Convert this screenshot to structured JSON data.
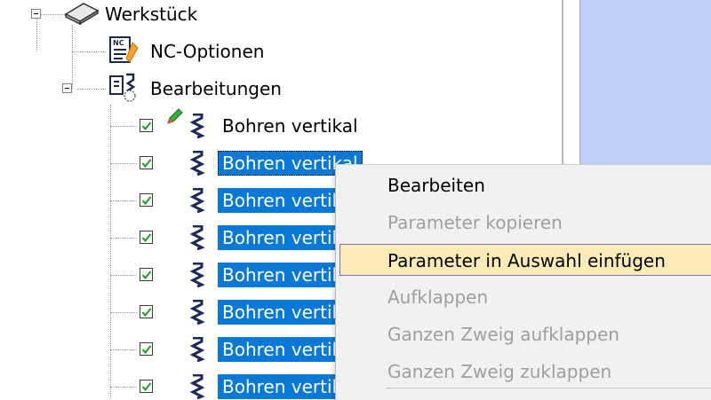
{
  "tree": {
    "workpiece": {
      "label": "Werkstück"
    },
    "nc_options": {
      "label": "NC-Optionen"
    },
    "operations": {
      "label": "Bearbeitungen"
    },
    "items": [
      {
        "label": "Bohren vertikal",
        "checked": true,
        "selected": false
      },
      {
        "label": "Bohren vertikal",
        "checked": true,
        "selected": true
      },
      {
        "label": "Bohren vertikal",
        "checked": true,
        "selected": true
      },
      {
        "label": "Bohren vertikal",
        "checked": true,
        "selected": true
      },
      {
        "label": "Bohren vertikal",
        "checked": true,
        "selected": true
      },
      {
        "label": "Bohren vertikal",
        "checked": true,
        "selected": true
      },
      {
        "label": "Bohren vertikal",
        "checked": true,
        "selected": true
      },
      {
        "label": "Bohren vertikal",
        "checked": true,
        "selected": true
      }
    ]
  },
  "context_menu": {
    "items": [
      {
        "label": "Bearbeiten",
        "enabled": true
      },
      {
        "label": "Parameter kopieren",
        "enabled": false
      },
      {
        "label": "Parameter in Auswahl einfügen",
        "enabled": true,
        "highlighted": true
      },
      {
        "label": "Aufklappen",
        "enabled": false
      },
      {
        "label": "Ganzen Zweig aufklappen",
        "enabled": false
      },
      {
        "label": "Ganzen Zweig zuklappen",
        "enabled": false
      }
    ]
  },
  "colors": {
    "selection": "#0a78d7",
    "menu_highlight": "#fcebb6",
    "right_panel": "#bfcef5",
    "check_green": "#18a018"
  }
}
